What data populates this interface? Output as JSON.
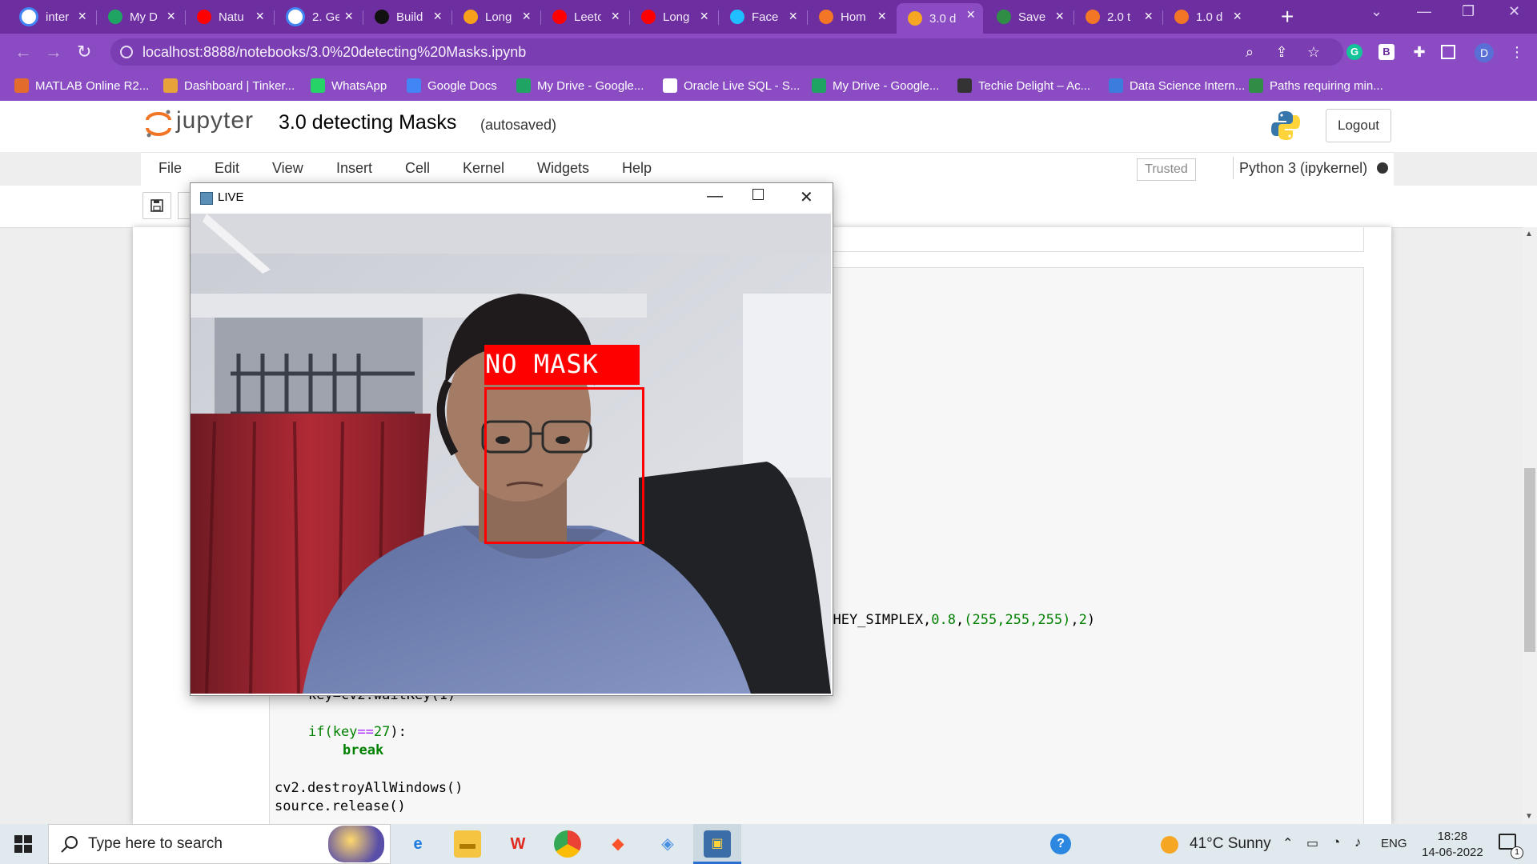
{
  "browser": {
    "tabs": [
      {
        "label": "inter",
        "icon": "google-icon"
      },
      {
        "label": "My D",
        "icon": "drive-icon"
      },
      {
        "label": "Natu",
        "icon": "youtube-icon"
      },
      {
        "label": "2. Ge",
        "icon": "globe-icon"
      },
      {
        "label": "Build",
        "icon": "medium-icon"
      },
      {
        "label": "Long",
        "icon": "leetcode-icon"
      },
      {
        "label": "Leetc",
        "icon": "youtube-icon"
      },
      {
        "label": "Long",
        "icon": "youtube-icon"
      },
      {
        "label": "Facer",
        "icon": "kaggle-icon"
      },
      {
        "label": "Hom",
        "icon": "jupyter-icon"
      },
      {
        "label": "3.0 d",
        "icon": "hourglass-icon",
        "active": true
      },
      {
        "label": "Save",
        "icon": "gfg-icon"
      },
      {
        "label": "2.0 t",
        "icon": "notebook-icon"
      },
      {
        "label": "1.0 d",
        "icon": "notebook-icon"
      }
    ],
    "url": "localhost:8888/notebooks/3.0%20detecting%20Masks.ipynb",
    "profile_initial": "D",
    "bookmarks": [
      "MATLAB Online R2...",
      "Dashboard | Tinker...",
      "WhatsApp",
      "Google Docs",
      "My Drive - Google...",
      "Oracle Live SQL - S...",
      "My Drive - Google...",
      "Techie Delight – Ac...",
      "Data Science Intern...",
      "Paths requiring min..."
    ]
  },
  "jupyter": {
    "logo": "jupyter",
    "notebook_title": "3.0 detecting Masks",
    "save_status": "(autosaved)",
    "logout_label": "Logout",
    "menu": [
      "File",
      "Edit",
      "View",
      "Insert",
      "Cell",
      "Kernel",
      "Widgets",
      "Help"
    ],
    "trusted_label": "Trusted",
    "kernel_name": "Python 3 (ipykernel)"
  },
  "code": {
    "visible_fragment_prefix": "RSHEY_SIMPLEX,",
    "fragment_num1": "0.8",
    "fragment_rgb": "(255,255,255)",
    "fragment_num2": "2",
    "waitkey_line": "key=cv2.waitKey(1)",
    "if_prefix": "if(key",
    "if_op": "==",
    "if_num": "27",
    "if_suffix": "):",
    "break_kw": "break",
    "destroy_line": "cv2.destroyAllWindows()",
    "release_line": "source.release()"
  },
  "live_window": {
    "title": "LIVE",
    "detection_label": "NO MASK",
    "box_color": "#ff0000"
  },
  "taskbar": {
    "search_placeholder": "Type here to search",
    "weather": "41°C  Sunny",
    "language": "ENG",
    "time": "18:28",
    "date": "14-06-2022",
    "notification_count": "1"
  }
}
